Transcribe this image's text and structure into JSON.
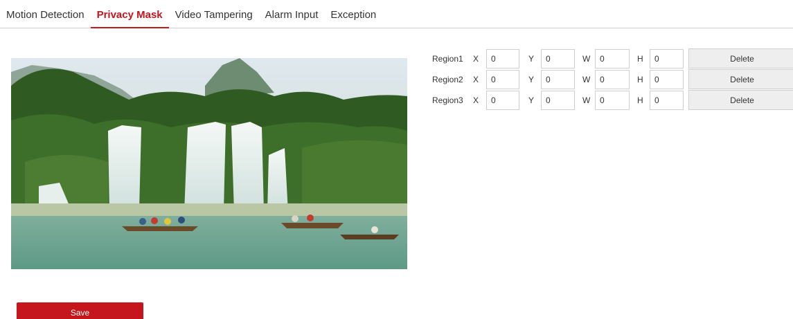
{
  "tabs": [
    {
      "label": "Motion Detection",
      "active": false
    },
    {
      "label": "Privacy Mask",
      "active": true
    },
    {
      "label": "Video Tampering",
      "active": false
    },
    {
      "label": "Alarm Input",
      "active": false
    },
    {
      "label": "Exception",
      "active": false
    }
  ],
  "regions": [
    {
      "label": "Region1",
      "x": "0",
      "y": "0",
      "w": "0",
      "h": "0"
    },
    {
      "label": "Region2",
      "x": "0",
      "y": "0",
      "w": "0",
      "h": "0"
    },
    {
      "label": "Region3",
      "x": "0",
      "y": "0",
      "w": "0",
      "h": "0"
    }
  ],
  "labels": {
    "x": "X",
    "y": "Y",
    "w": "W",
    "h": "H",
    "delete": "Delete"
  },
  "save_label": "Save",
  "colors": {
    "accent": "#c4161c",
    "border": "#cfcfcf",
    "button_bg": "#eeeeee"
  }
}
